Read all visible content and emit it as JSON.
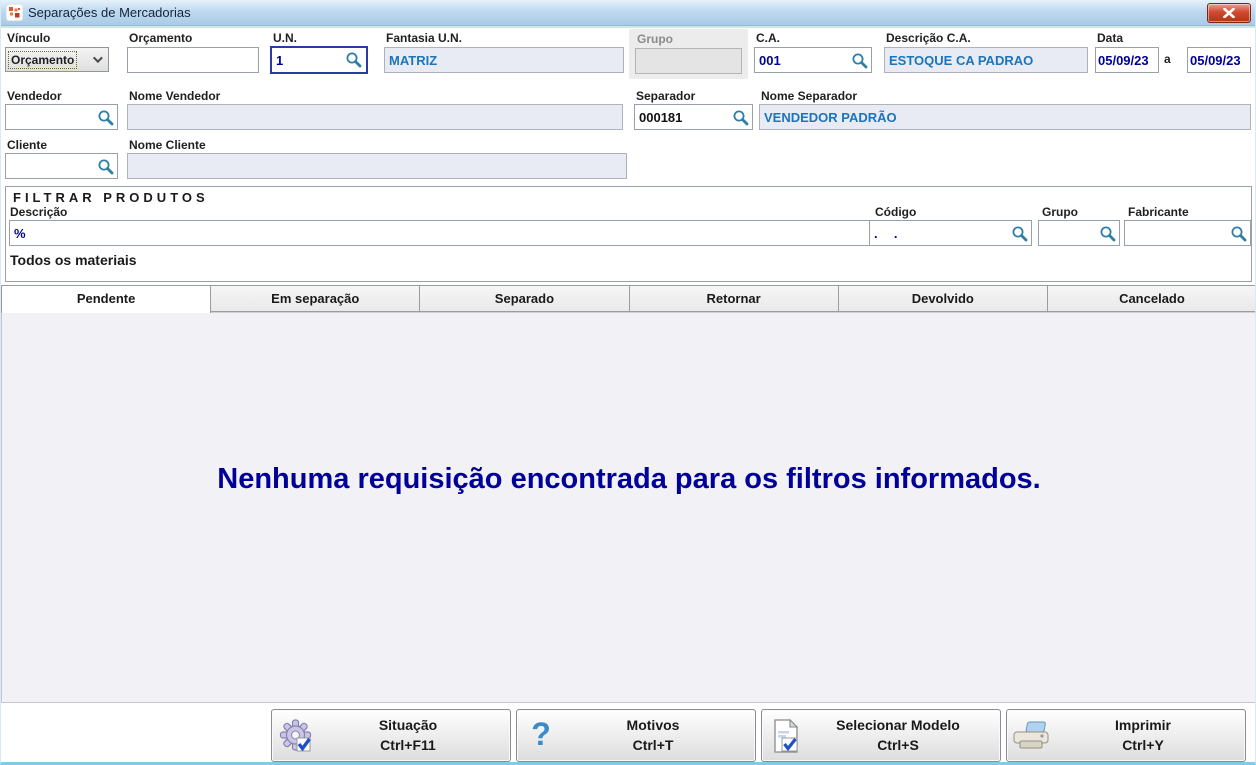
{
  "colors": {
    "value_navy": "#000099",
    "readonly_text_blue": "#1b75bc",
    "search_icon_teal": "#2e7fa8",
    "message_blue": "#000099",
    "titlebar_blue": "#bed9f0",
    "close_button_red": "#cf4a30",
    "window_border_cyan": "#7fcce8"
  },
  "window": {
    "title": "Separações de Mercadorias"
  },
  "form": {
    "vinculo": {
      "label": "Vínculo",
      "value": "Orçamento"
    },
    "orcamento": {
      "label": "Orçamento",
      "value": ""
    },
    "un": {
      "label": "U.N.",
      "value": "1"
    },
    "fantasia_un": {
      "label": "Fantasia U.N.",
      "value": "MATRIZ"
    },
    "grupo": {
      "label": "Grupo",
      "value": ""
    },
    "ca": {
      "label": "C.A.",
      "value": "001"
    },
    "descricao_ca": {
      "label": "Descrição C.A.",
      "value": "ESTOQUE CA PADRAO"
    },
    "data": {
      "label": "Data",
      "from": "05/09/23",
      "conj": "a",
      "to": "05/09/23"
    },
    "vendedor": {
      "label": "Vendedor",
      "value": ""
    },
    "nome_vendedor": {
      "label": "Nome Vendedor",
      "value": ""
    },
    "separador": {
      "label": "Separador",
      "value": "000181"
    },
    "nome_separador": {
      "label": "Nome Separador",
      "value": "VENDEDOR PADRÃO"
    },
    "cliente": {
      "label": "Cliente",
      "value": ""
    },
    "nome_cliente": {
      "label": "Nome Cliente",
      "value": ""
    }
  },
  "filter": {
    "title": "FILTRAR PRODUTOS",
    "descricao": {
      "label": "Descrição",
      "value": "%"
    },
    "codigo": {
      "label": "Código",
      "value": ".  ."
    },
    "grupo": {
      "label": "Grupo",
      "value": ""
    },
    "fabricante": {
      "label": "Fabricante",
      "value": ""
    },
    "footnote": "Todos os materiais"
  },
  "tabs": [
    {
      "label": "Pendente",
      "active": true
    },
    {
      "label": "Em separação",
      "active": false
    },
    {
      "label": "Separado",
      "active": false
    },
    {
      "label": "Retornar",
      "active": false
    },
    {
      "label": "Devolvido",
      "active": false
    },
    {
      "label": "Cancelado",
      "active": false
    }
  ],
  "content": {
    "empty_message": "Nenhuma requisição encontrada para os filtros informados."
  },
  "footer": {
    "buttons": [
      {
        "label": "Situação",
        "shortcut": "Ctrl+F11",
        "icon": "gear-check-icon"
      },
      {
        "label": "Motivos",
        "shortcut": "Ctrl+T",
        "icon": "question-icon"
      },
      {
        "label": "Selecionar Modelo",
        "shortcut": "Ctrl+S",
        "icon": "document-check-icon"
      },
      {
        "label": "Imprimir",
        "shortcut": "Ctrl+Y",
        "icon": "printer-icon"
      }
    ]
  }
}
